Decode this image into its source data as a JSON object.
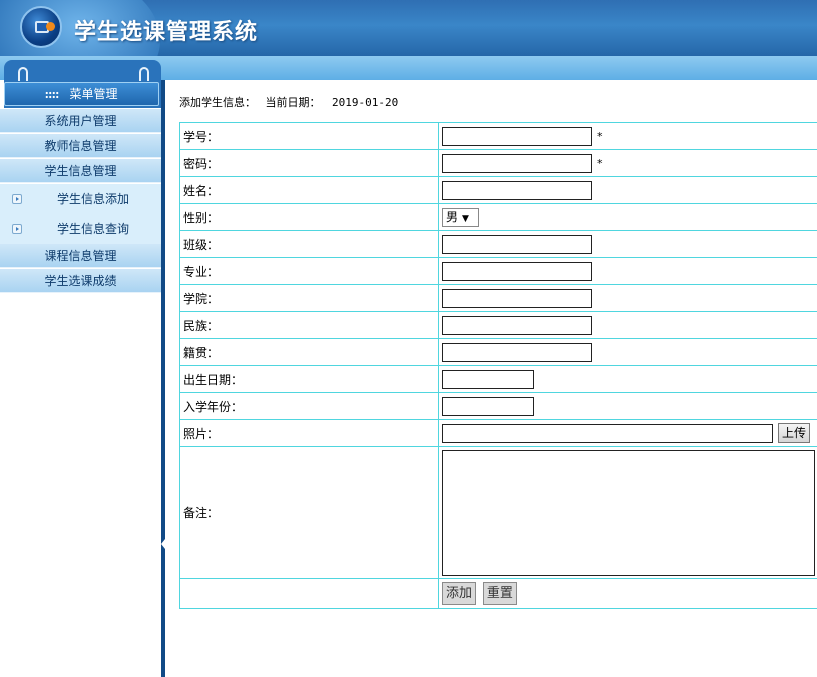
{
  "app": {
    "title": "学生选课管理系统"
  },
  "sidebar": {
    "menu_title": "菜单管理",
    "items": [
      {
        "label": "系统用户管理"
      },
      {
        "label": "教师信息管理"
      },
      {
        "label": "学生信息管理"
      },
      {
        "label": "学生信息添加"
      },
      {
        "label": "学生信息查询"
      },
      {
        "label": "课程信息管理"
      },
      {
        "label": "学生选课成绩"
      }
    ]
  },
  "main": {
    "page_label": "添加学生信息：",
    "date_label": "当前日期：",
    "current_date": "2019-01-20",
    "fields": {
      "student_id": "学号：",
      "password": "密码：",
      "name": "姓名：",
      "gender": "性别：",
      "class": "班级：",
      "major": "专业：",
      "college": "学院：",
      "ethnicity": "民族：",
      "hometown": "籍贯：",
      "birth_date": "出生日期：",
      "enroll_year": "入学年份：",
      "photo": "照片：",
      "remark": "备注："
    },
    "required_mark": "*",
    "gender_selected": "男",
    "upload_button": "上传",
    "add_button": "添加",
    "reset_button": "重置"
  }
}
